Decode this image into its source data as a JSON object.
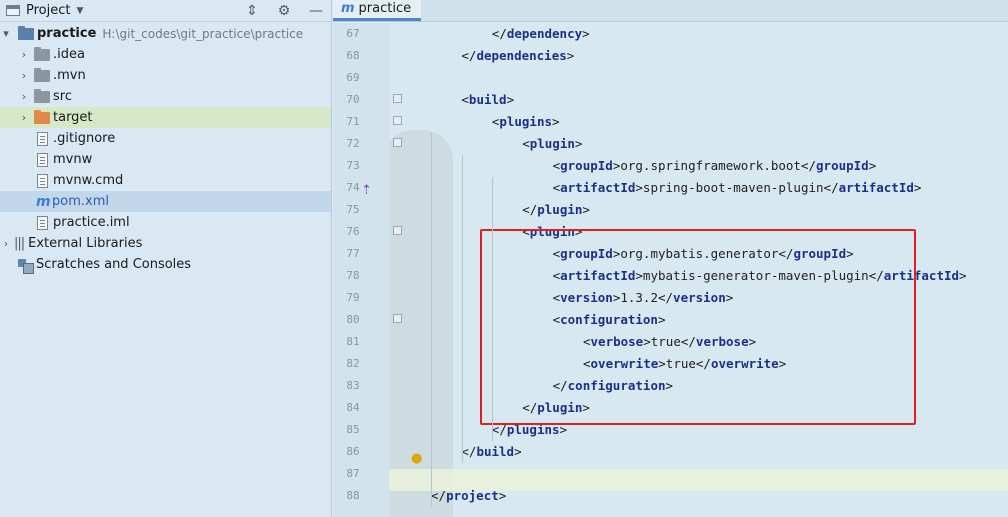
{
  "project_panel": {
    "title": "Project",
    "tree": [
      {
        "name": "practice",
        "path": "H:\\git_codes\\git_practice\\practice"
      },
      {
        "name": ".idea"
      },
      {
        "name": ".mvn"
      },
      {
        "name": "src"
      },
      {
        "name": "target"
      },
      {
        "name": ".gitignore"
      },
      {
        "name": "mvnw"
      },
      {
        "name": "mvnw.cmd"
      },
      {
        "name": "pom.xml"
      },
      {
        "name": "practice.iml"
      },
      {
        "name": "External Libraries"
      },
      {
        "name": "Scratches and Consoles"
      }
    ]
  },
  "editor": {
    "tab": {
      "icon": "m",
      "label": "practice"
    },
    "line_numbers": [
      "67",
      "68",
      "69",
      "70",
      "71",
      "72",
      "73",
      "74",
      "75",
      "76",
      "77",
      "78",
      "79",
      "80",
      "81",
      "82",
      "83",
      "84",
      "85",
      "86",
      "87",
      "88"
    ],
    "code": [
      {
        "tag": "dependency",
        "close": true
      },
      {
        "tag": "dependencies",
        "close": true
      },
      {},
      {
        "tag": "build"
      },
      {
        "tag": "plugins"
      },
      {
        "tag": "plugin"
      },
      {
        "tag": "groupId",
        "value": "org.springframework.boot"
      },
      {
        "tag": "artifactId",
        "value": "spring-boot-maven-plugin"
      },
      {
        "tag": "plugin",
        "close": true
      },
      {
        "tag": "plugin"
      },
      {
        "tag": "groupId",
        "value": "org.mybatis.generator"
      },
      {
        "tag": "artifactId",
        "value": "mybatis-generator-maven-plugin"
      },
      {
        "tag": "version",
        "value": "1.3.2"
      },
      {
        "tag": "configuration"
      },
      {
        "tag": "verbose",
        "value": "true"
      },
      {
        "tag": "overwrite",
        "value": "true"
      },
      {
        "tag": "configuration",
        "close": true
      },
      {
        "tag": "plugin",
        "close": true
      },
      {
        "tag": "plugins",
        "close": true
      },
      {
        "tag": "build",
        "close": true
      },
      {},
      {
        "tag": "project",
        "close": true
      }
    ]
  },
  "colors": {
    "tag": "#1d2f8a",
    "highlight_box": "#e02020",
    "tab_underline": "#4a88c7"
  }
}
